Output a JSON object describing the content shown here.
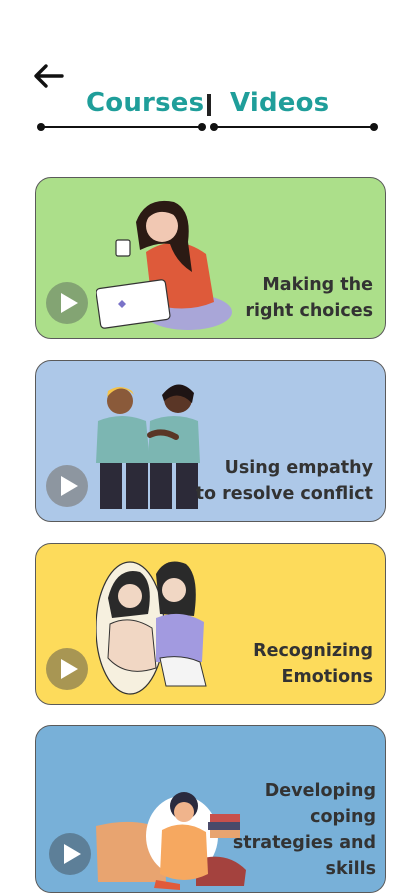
{
  "header": {
    "back_icon": "arrow-left-icon"
  },
  "tabs": [
    {
      "label": "Courses"
    },
    {
      "label": "Videos"
    }
  ],
  "cards": [
    {
      "title": "Making the\nright choices",
      "bg": "#acdf8a",
      "illustration": "woman-laptop-coffee-illustration",
      "play_icon": "play-icon"
    },
    {
      "title": "Using empathy\nto resolve conflict",
      "bg": "#adc8e8",
      "illustration": "two-men-comforting-illustration",
      "play_icon": "play-icon"
    },
    {
      "title": "Recognizing\nEmotions",
      "bg": "#fddb5b",
      "illustration": "girl-mirror-reflection-illustration",
      "play_icon": "play-icon"
    },
    {
      "title": "Developing\ncoping\nstrategies and\nskills",
      "bg": "#78b0d8",
      "illustration": "boy-sitting-books-illustration",
      "play_icon": "play-icon"
    }
  ]
}
